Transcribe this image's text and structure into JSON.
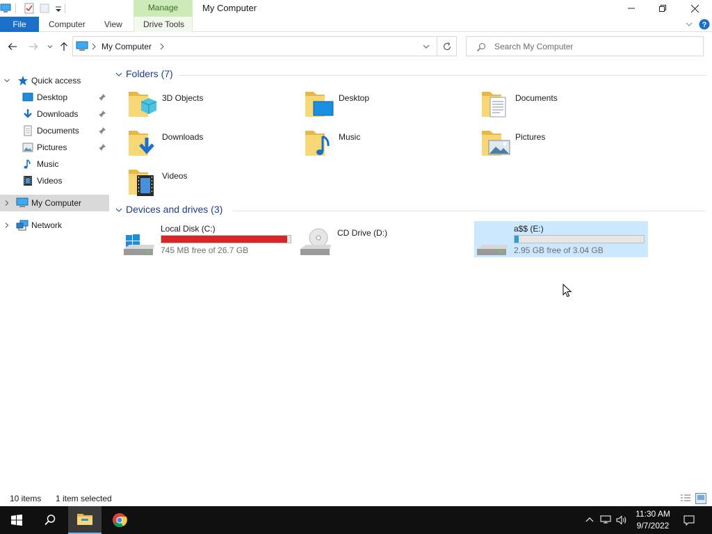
{
  "window": {
    "title": "My Computer",
    "context_tab": "Manage",
    "controls": [
      "minimize",
      "restore",
      "close"
    ]
  },
  "ribbon": {
    "file": "File",
    "tabs": [
      "Computer",
      "View",
      "Drive Tools"
    ]
  },
  "address": {
    "path": "My Computer",
    "search_placeholder": "Search My Computer"
  },
  "navpane": {
    "quick_access": "Quick access",
    "quick_items": [
      {
        "label": "Desktop",
        "icon": "desktop-icon",
        "pinned": true
      },
      {
        "label": "Downloads",
        "icon": "downloads-icon",
        "pinned": true
      },
      {
        "label": "Documents",
        "icon": "documents-icon",
        "pinned": true
      },
      {
        "label": "Pictures",
        "icon": "pictures-icon",
        "pinned": true
      },
      {
        "label": "Music",
        "icon": "music-icon",
        "pinned": false
      },
      {
        "label": "Videos",
        "icon": "videos-icon",
        "pinned": false
      }
    ],
    "my_computer": "My Computer",
    "network": "Network"
  },
  "content": {
    "folders_header": "Folders (7)",
    "folders": [
      {
        "name": "3D Objects",
        "icon": "3d-objects-folder-icon"
      },
      {
        "name": "Desktop",
        "icon": "desktop-folder-icon"
      },
      {
        "name": "Documents",
        "icon": "documents-folder-icon"
      },
      {
        "name": "Downloads",
        "icon": "downloads-folder-icon"
      },
      {
        "name": "Music",
        "icon": "music-folder-icon"
      },
      {
        "name": "Pictures",
        "icon": "pictures-folder-icon"
      },
      {
        "name": "Videos",
        "icon": "videos-folder-icon"
      }
    ],
    "drives_header": "Devices and drives (3)",
    "drives": [
      {
        "name": "Local Disk (C:)",
        "free": "745 MB free of 26.7 GB",
        "used_fraction": 0.973,
        "bar_color": "#da2626",
        "icon": "windows-drive-icon"
      },
      {
        "name": "CD Drive (D:)",
        "icon": "cd-drive-icon"
      },
      {
        "name": "a$$ (E:)",
        "free": "2.95 GB free of 3.04 GB",
        "used_fraction": 0.03,
        "bar_color": "#26a0da",
        "icon": "usb-drive-icon",
        "selected": true
      }
    ]
  },
  "status": {
    "items": "10 items",
    "selected": "1 item selected"
  },
  "taskbar": {
    "time": "11:30 AM",
    "date": "9/7/2022"
  },
  "colors": {
    "accent": "#1a6fc9",
    "manage_tab": "#cdebb9",
    "selection": "#cce8ff",
    "taskbar": "#101010"
  }
}
